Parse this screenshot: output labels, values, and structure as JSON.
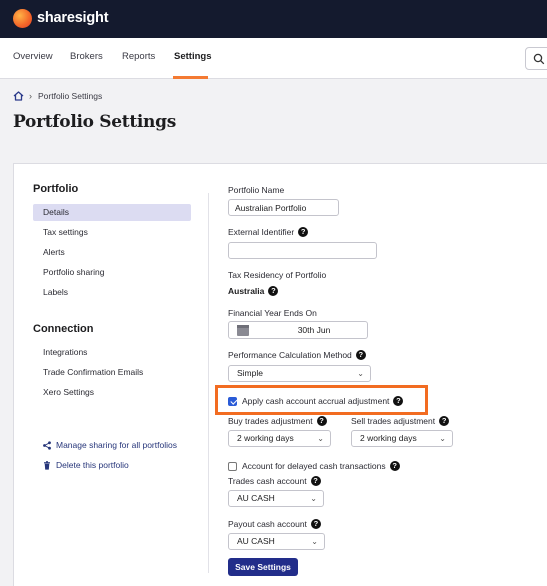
{
  "brand": {
    "name": "sharesight"
  },
  "nav": {
    "tabs": [
      {
        "label": "Overview"
      },
      {
        "label": "Brokers"
      },
      {
        "label": "Reports"
      },
      {
        "label": "Settings"
      }
    ],
    "active_tab": "Settings"
  },
  "breadcrumb": {
    "current": "Portfolio Settings"
  },
  "page": {
    "title": "Portfolio Settings"
  },
  "sidebar": {
    "portfolio_heading": "Portfolio",
    "portfolio_items": [
      {
        "label": "Details"
      },
      {
        "label": "Tax settings"
      },
      {
        "label": "Alerts"
      },
      {
        "label": "Portfolio sharing"
      },
      {
        "label": "Labels"
      }
    ],
    "connection_heading": "Connection",
    "connection_items": [
      {
        "label": "Integrations"
      },
      {
        "label": "Trade Confirmation Emails"
      },
      {
        "label": "Xero Settings"
      }
    ],
    "links": [
      {
        "label": "Manage sharing for all portfolios",
        "icon": "share-icon"
      },
      {
        "label": "Delete this portfolio",
        "icon": "trash-icon"
      }
    ]
  },
  "form": {
    "portfolio_name": {
      "label": "Portfolio Name",
      "value": "Australian Portfolio"
    },
    "external_identifier": {
      "label": "External Identifier",
      "value": ""
    },
    "tax_residency": {
      "label": "Tax Residency of Portfolio",
      "value": "Australia"
    },
    "financial_year_end": {
      "label": "Financial Year Ends On",
      "value": "30th Jun"
    },
    "performance_method": {
      "label": "Performance Calculation Method",
      "value": "Simple"
    },
    "cash_accrual": {
      "label": "Apply cash account accrual adjustment",
      "checked": true
    },
    "buy_trades": {
      "label": "Buy trades adjustment",
      "value": "2 working days"
    },
    "sell_trades": {
      "label": "Sell trades adjustment",
      "value": "2 working days"
    },
    "delayed_cash": {
      "label": "Account for delayed cash transactions",
      "checked": false
    },
    "trades_cash_account": {
      "label": "Trades cash account",
      "value": "AU CASH"
    },
    "payout_cash_account": {
      "label": "Payout cash account",
      "value": "AU CASH"
    },
    "save_label": "Save Settings"
  },
  "colors": {
    "topbar": "#141a2e",
    "accent": "#f47a32",
    "highlight": "#f26c21",
    "primary_button": "#222d8a",
    "checkbox": "#2a5bd7"
  }
}
